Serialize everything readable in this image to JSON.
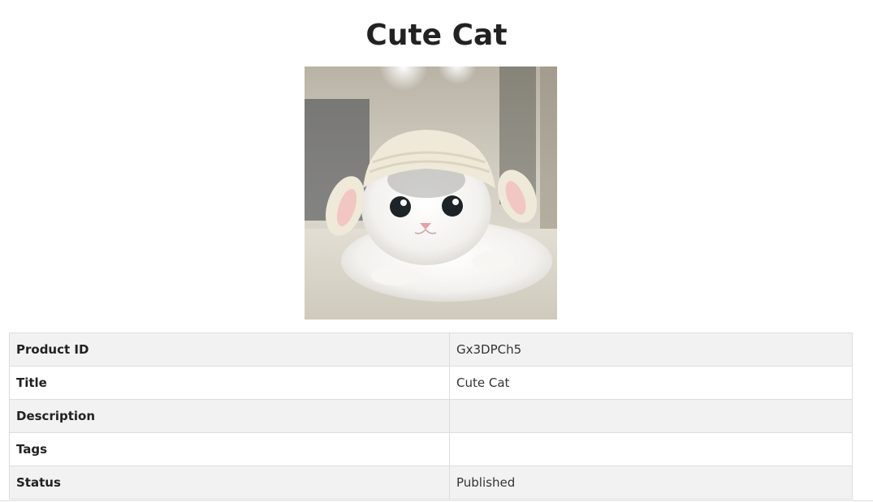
{
  "page": {
    "title": "Cute Cat"
  },
  "image": {
    "subject": "white-kitten-in-knitted-hat"
  },
  "details": [
    {
      "label": "Product ID",
      "value": "Gx3DPCh5"
    },
    {
      "label": "Title",
      "value": "Cute Cat"
    },
    {
      "label": "Description",
      "value": ""
    },
    {
      "label": "Tags",
      "value": ""
    },
    {
      "label": "Status",
      "value": "Published"
    }
  ],
  "colors": {
    "row_stripe": "#f2f2f2",
    "row_plain": "#ffffff",
    "border": "#dddddd",
    "text": "#222222"
  }
}
